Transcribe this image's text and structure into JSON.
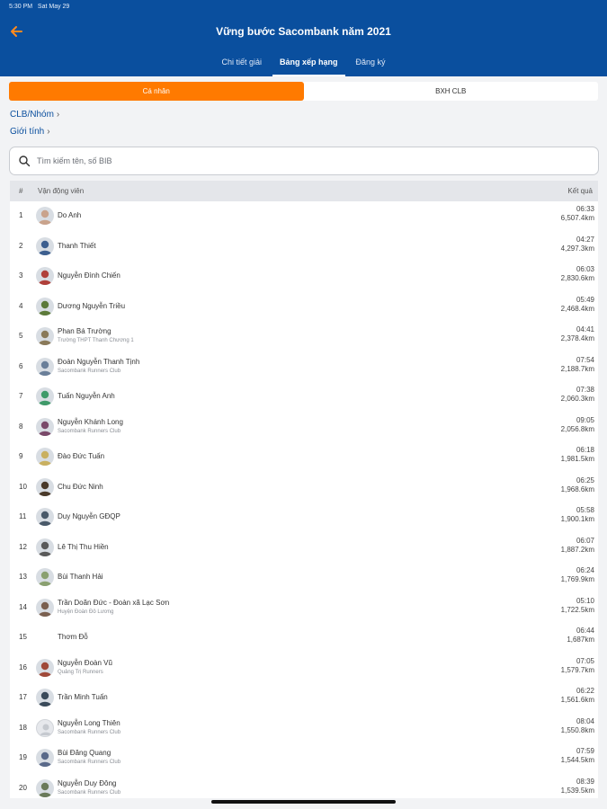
{
  "status_bar": {
    "time": "5:30 PM",
    "date": "Sat May 29"
  },
  "header": {
    "title": "Vững bước Sacombank năm 2021",
    "tabs": [
      {
        "label": "Chi tiết giải",
        "active": false
      },
      {
        "label": "Bảng xếp hạng",
        "active": true
      },
      {
        "label": "Đăng ký",
        "active": false
      }
    ]
  },
  "segments": [
    {
      "label": "Cá nhân",
      "active": true
    },
    {
      "label": "BXH CLB",
      "active": false
    }
  ],
  "filters": {
    "club_group": "CLB/Nhóm",
    "gender": "Giới tính"
  },
  "search": {
    "placeholder": "Tìm kiếm tên, số BIB",
    "value": ""
  },
  "table": {
    "headers": {
      "rank": "#",
      "athlete": "Vận động viên",
      "result": "Kết quả"
    },
    "rows": [
      {
        "rank": "1",
        "name": "Do Anh",
        "club": "",
        "pace": "06:33",
        "distance": "6,507.4km",
        "avatar": "#c9a38c"
      },
      {
        "rank": "2",
        "name": "Thanh Thiết",
        "club": "",
        "pace": "04:27",
        "distance": "4,297.3km",
        "avatar": "#3d5f8f"
      },
      {
        "rank": "3",
        "name": "Nguyễn Đình Chiến",
        "club": "",
        "pace": "06:03",
        "distance": "2,830.6km",
        "avatar": "#b0403a"
      },
      {
        "rank": "4",
        "name": "Dương Nguyễn Triều",
        "club": "",
        "pace": "05:49",
        "distance": "2,468.4km",
        "avatar": "#5c7a3a"
      },
      {
        "rank": "5",
        "name": "Phan Bá Trường",
        "club": "Trường THPT Thanh Chương 1",
        "pace": "04:41",
        "distance": "2,378.4km",
        "avatar": "#8a7a5a"
      },
      {
        "rank": "6",
        "name": "Đoàn Nguyễn Thanh Tịnh",
        "club": "Sacombank Runners Club",
        "pace": "07:54",
        "distance": "2,188.7km",
        "avatar": "#6a7f99"
      },
      {
        "rank": "7",
        "name": "Tuấn Nguyễn Anh",
        "club": "",
        "pace": "07:38",
        "distance": "2,060.3km",
        "avatar": "#3f9a6a"
      },
      {
        "rank": "8",
        "name": "Nguyễn Khánh Long",
        "club": "Sacombank Runners Club",
        "pace": "09:05",
        "distance": "2,056.8km",
        "avatar": "#7a4a6a"
      },
      {
        "rank": "9",
        "name": "Đào Đức Tuấn",
        "club": "",
        "pace": "06:18",
        "distance": "1,981.5km",
        "avatar": "#c9b060"
      },
      {
        "rank": "10",
        "name": "Chu Đức Ninh",
        "club": "",
        "pace": "06:25",
        "distance": "1,968.6km",
        "avatar": "#4a3a2a"
      },
      {
        "rank": "11",
        "name": "Duy Nguyễn GĐQP",
        "club": "",
        "pace": "05:58",
        "distance": "1,900.1km",
        "avatar": "#4a5a6a"
      },
      {
        "rank": "12",
        "name": "Lê Thị Thu Hiền",
        "club": "",
        "pace": "06:07",
        "distance": "1,887.2km",
        "avatar": "#5a5a5a"
      },
      {
        "rank": "13",
        "name": "Bùi Thanh Hải",
        "club": "",
        "pace": "06:24",
        "distance": "1,769.9km",
        "avatar": "#8aa070"
      },
      {
        "rank": "14",
        "name": "Trần Doãn Đức - Đoàn  xã  Lạc Sơn",
        "club": "Huyện Đoàn Đô Lương",
        "pace": "05:10",
        "distance": "1,722.5km",
        "avatar": "#7a6050"
      },
      {
        "rank": "15",
        "name": "Thơm Đỗ",
        "club": "",
        "pace": "06:44",
        "distance": "1,687km",
        "avatar": ""
      },
      {
        "rank": "16",
        "name": "Nguyễn Đoàn Vũ",
        "club": "Quảng Trị Runners",
        "pace": "07:05",
        "distance": "1,579.7km",
        "avatar": "#a04a3a"
      },
      {
        "rank": "17",
        "name": "Trần Minh Tuấn",
        "club": "",
        "pace": "06:22",
        "distance": "1,561.6km",
        "avatar": "#3a4a5a"
      },
      {
        "rank": "18",
        "name": "Nguyễn Long Thiên",
        "club": "Sacombank Runners Club",
        "pace": "08:04",
        "distance": "1,550.8km",
        "avatar": "blank"
      },
      {
        "rank": "19",
        "name": "Bùi Đăng Quang",
        "club": "Sacombank Runners Club",
        "pace": "07:59",
        "distance": "1,544.5km",
        "avatar": "#5a6a8a"
      },
      {
        "rank": "20",
        "name": "Nguyễn Duy Đông",
        "club": "Sacombank Runners Club",
        "pace": "08:39",
        "distance": "1,539.5km",
        "avatar": "#6a7a5a"
      }
    ]
  },
  "colors": {
    "header_bg": "#0a4f9e",
    "accent_orange": "#ff7a00",
    "link_blue": "#0a4f9e"
  }
}
